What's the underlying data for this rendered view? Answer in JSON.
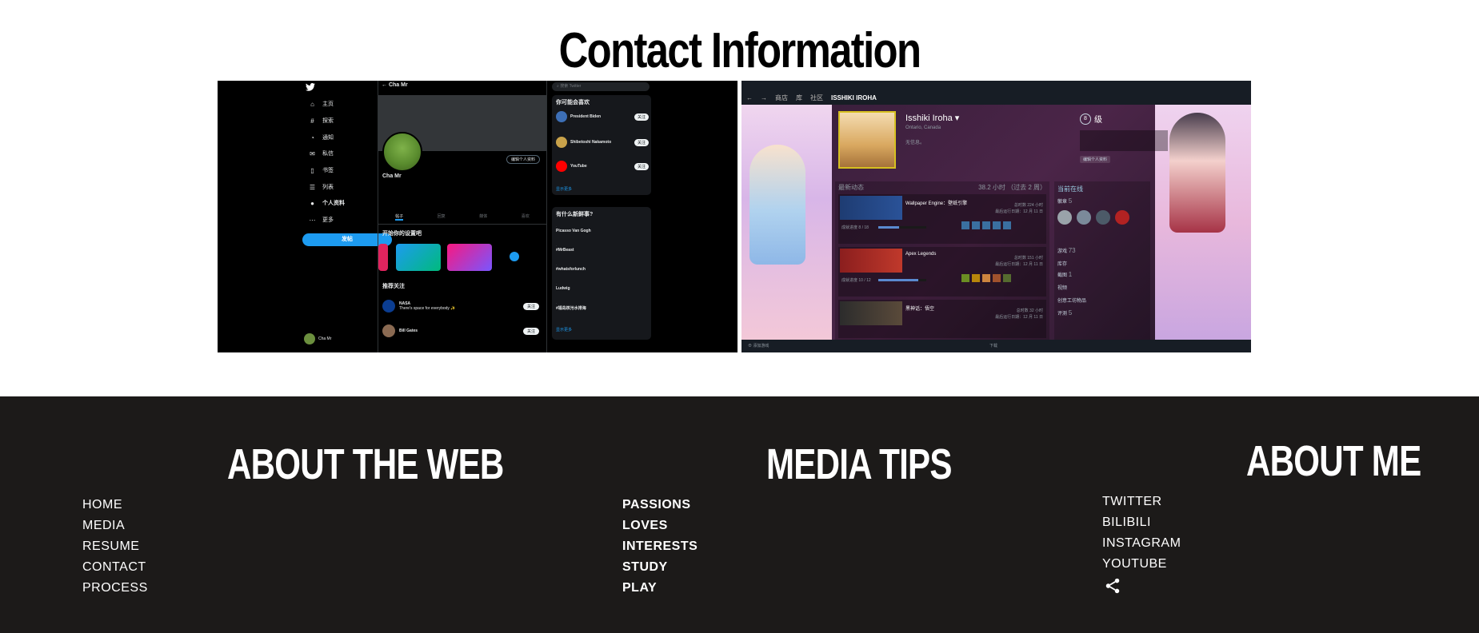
{
  "page": {
    "title": "Contact Information"
  },
  "twitter": {
    "nav": [
      "主页",
      "探索",
      "通知",
      "私信",
      "书签",
      "列表",
      "个人资料",
      "更多"
    ],
    "post_label": "发帖",
    "profile_name": "Cha Mr",
    "search_placeholder": "搜索 Twitter",
    "edit_profile": "编辑个人资料",
    "tabs": [
      "帖子",
      "回复",
      "媒体",
      "喜欢"
    ],
    "section_start": "开始你的设置吧",
    "section_follow": "推荐关注",
    "you_may_like": "你可能会喜欢",
    "whats_happening": "有什么新鲜事?",
    "show_more": "显示更多",
    "suggestions": [
      {
        "name": "President Biden",
        "btn": "关注"
      },
      {
        "name": "Shibetoshi Nakamoto",
        "btn": "关注"
      },
      {
        "name": "YouTube",
        "btn": "关注"
      }
    ],
    "trends": [
      "Picasso Van Gogh",
      "#MrBeast",
      "#whatsforlunch",
      "Ludwig",
      "#福岛核污水排海"
    ],
    "follow": [
      {
        "name": "NASA",
        "text": "There's space for everybody ✨",
        "btn": "关注"
      },
      {
        "name": "Bill Gates",
        "btn": "关注"
      }
    ],
    "me_name": "Cha Mr"
  },
  "steam": {
    "nav": [
      "商店",
      "库",
      "社区"
    ],
    "nav_current": "ISSHIKI IROHA",
    "username": "Isshiki Iroha",
    "location": "Ontario, Canada",
    "no_info": "无信息。",
    "level_label": "级",
    "level": "8",
    "edit_profile": "编辑个人资料",
    "recent_activity": "最新动态",
    "recent_hours": "38.2 小时 （过去 2 周）",
    "online": "当前在线",
    "games": [
      {
        "name": "Wallpaper Engine：壁纸引擎",
        "hours": "总时数 224 小时",
        "last": "最后运行日期：12 月 11 日",
        "progress_label": "成就进度",
        "progress": "8 / 18",
        "fill": 0.44
      },
      {
        "name": "Apex Legends",
        "hours": "总时数 151 小时",
        "last": "最后运行日期：12 月 11 日",
        "progress_label": "成就进度",
        "progress": "10 / 12",
        "fill": 0.83
      },
      {
        "name": "黑神话：悟空",
        "hours": "总时数 32 小时",
        "last": "最后运行日期：12 月 11 日"
      }
    ],
    "stats": [
      {
        "label": "徽章",
        "value": "5"
      },
      {
        "label": "游戏",
        "value": "73"
      },
      {
        "label": "库存",
        "value": ""
      },
      {
        "label": "截图",
        "value": "1"
      },
      {
        "label": "视频",
        "value": ""
      },
      {
        "label": "创意工坊物品",
        "value": ""
      },
      {
        "label": "评测",
        "value": "5"
      }
    ],
    "add_game": "添加游戏",
    "downloads": "下载"
  },
  "footer": {
    "about_web": {
      "heading": "ABOUT THE WEB",
      "links": [
        "HOME",
        "MEDIA",
        "RESUME",
        "CONTACT",
        "PROCESS"
      ]
    },
    "media_tips": {
      "heading": "MEDIA TIPS",
      "links": [
        "PASSIONS",
        "LOVES",
        "INTERESTS",
        "STUDY",
        "PLAY"
      ]
    },
    "about_me": {
      "heading": "ABOUT ME",
      "links": [
        "TWITTER",
        "BILIBILI",
        "INSTAGRAM",
        "YOUTUBE"
      ]
    },
    "share_icon": "share-icon"
  }
}
